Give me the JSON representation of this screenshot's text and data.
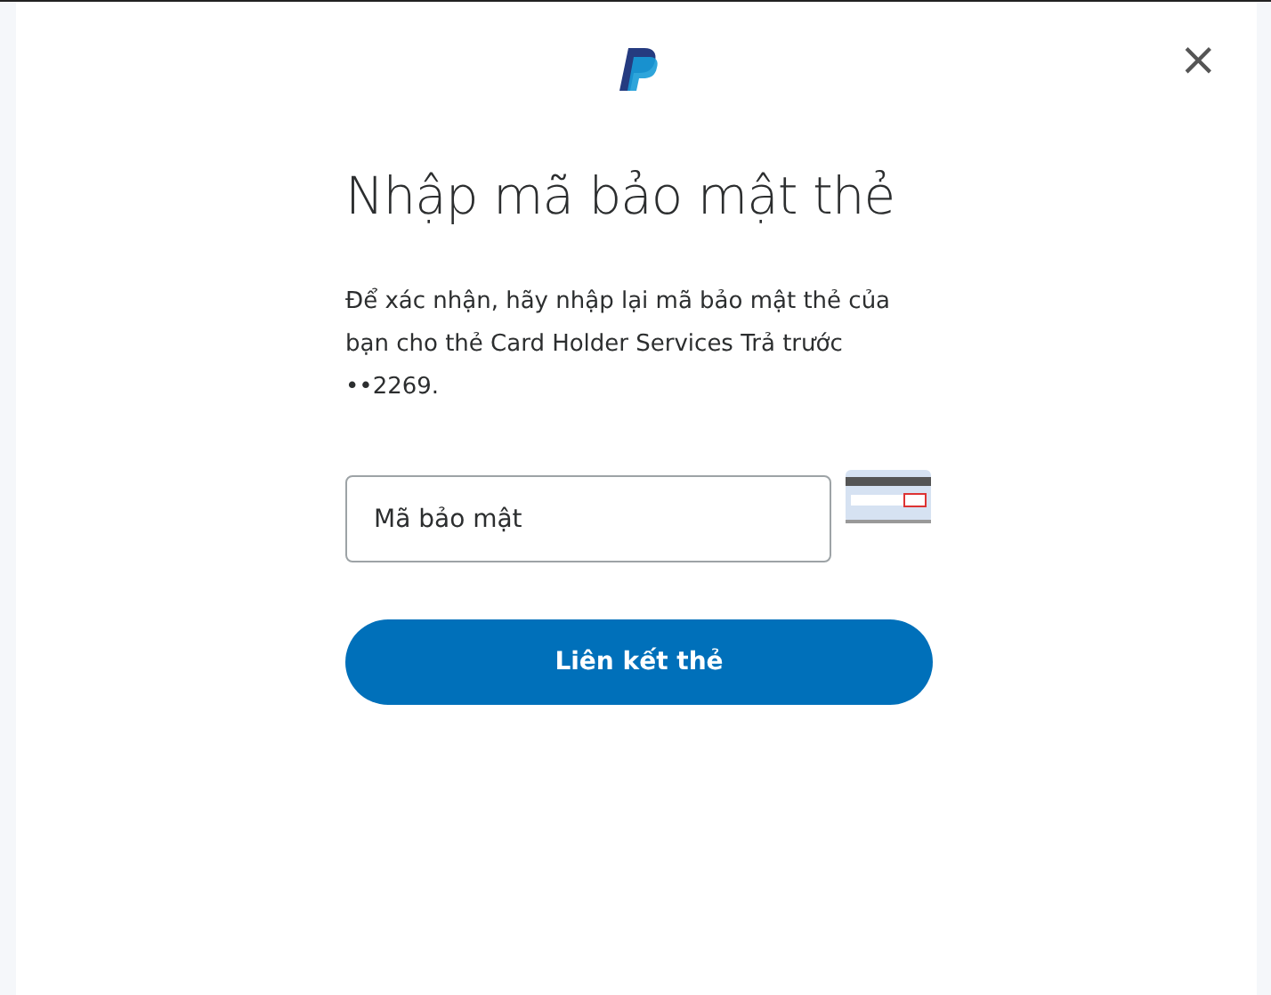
{
  "close_label": "×",
  "title": "Nhập mã bảo mật thẻ",
  "message": "Để xác nhận, hãy nhập lại mã bảo mật thẻ của bạn cho thẻ Card Holder Services Trả trước ••2269.",
  "security_code": {
    "placeholder": "Mã bảo mật"
  },
  "submit_button": "Liên kết thẻ"
}
